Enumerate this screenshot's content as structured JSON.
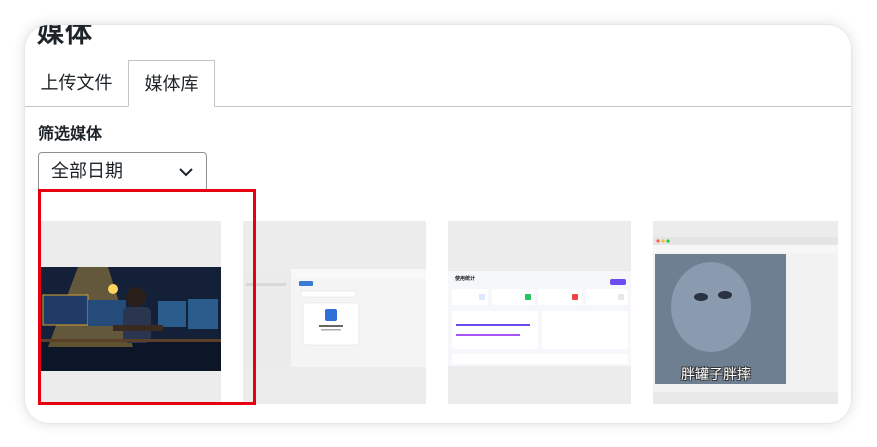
{
  "page": {
    "title": "媒体"
  },
  "tabs": [
    {
      "label": "上传文件",
      "active": false
    },
    {
      "label": "媒体库",
      "active": true
    }
  ],
  "filter": {
    "label": "筛选媒体",
    "date_selected": "全部日期"
  },
  "media": [
    {
      "name": "person-coding-at-desk-illustration",
      "selected": true
    },
    {
      "name": "app-window-screenshot"
    },
    {
      "name": "usage-statistics-dashboard-screenshot",
      "title": "使用统计"
    },
    {
      "name": "meme-image-viewer-screenshot",
      "caption": "胖罐子胖摔"
    }
  ],
  "colors": {
    "selection": "#e60012",
    "tab_border": "#c3c4c7",
    "tile_bg": "#ececec"
  }
}
